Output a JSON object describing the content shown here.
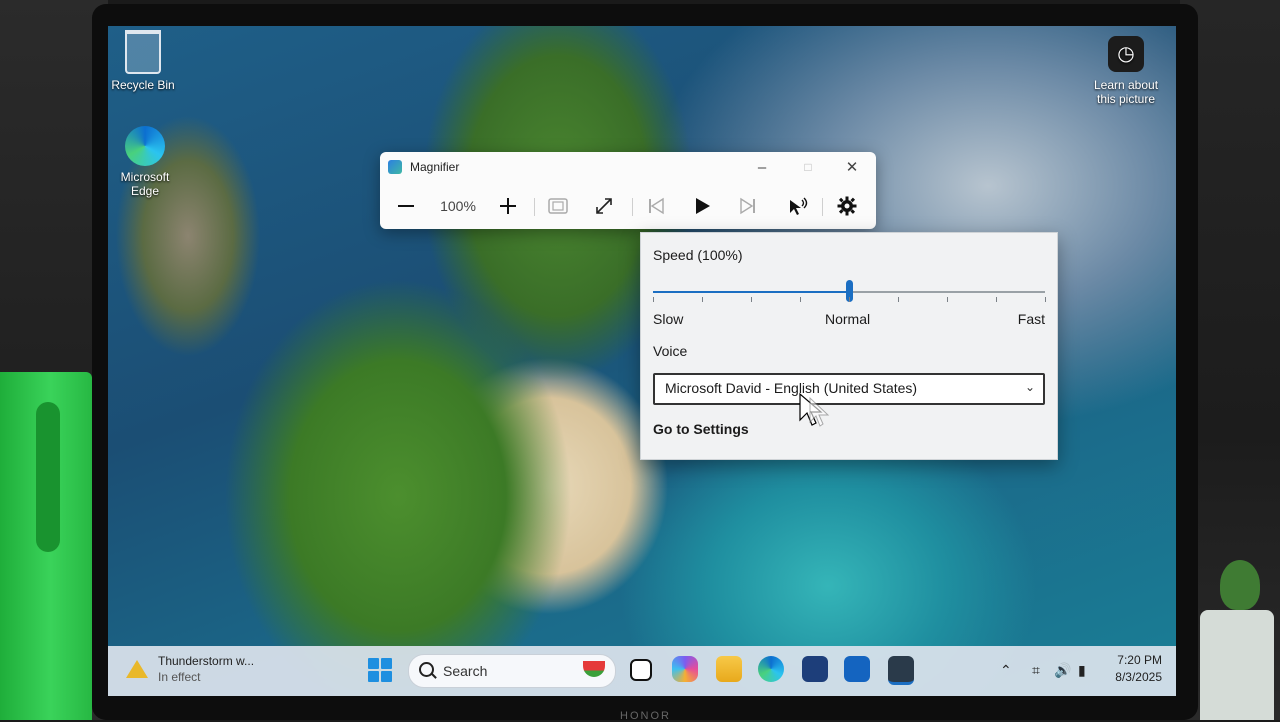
{
  "desktop": {
    "icons": [
      {
        "label": "Recycle Bin",
        "icon": "recycle-bin-icon"
      },
      {
        "label": "Microsoft\nEdge",
        "icon": "edge-icon"
      }
    ],
    "learn_about": "Learn about\nthis picture"
  },
  "magnifier": {
    "title": "Magnifier",
    "zoom": "100%",
    "buttons": [
      "zoom-out",
      "zoom-in",
      "lens-view",
      "full-screen",
      "read-previous",
      "play",
      "read-next",
      "read-from-here",
      "settings"
    ]
  },
  "flyout": {
    "speed_label": "Speed (100%)",
    "speed_value": 0.5,
    "speed_slow": "Slow",
    "speed_normal": "Normal",
    "speed_fast": "Fast",
    "voice_label": "Voice",
    "voice_value": "Microsoft David - English (United States)",
    "go_settings": "Go to Settings"
  },
  "taskbar": {
    "weather_title": "Thunderstorm w...",
    "weather_sub": "In effect",
    "search_placeholder": "Search",
    "time": "7:20 PM",
    "date": "8/3/2025"
  },
  "device": {
    "brand": "HONOR"
  },
  "colors": {
    "accent": "#1b6ec2",
    "taskbar": "#dae2ec",
    "warning": "#e9b82a"
  }
}
